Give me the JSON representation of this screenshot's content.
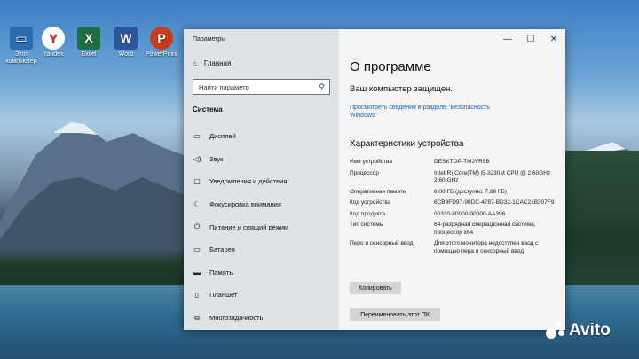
{
  "desktop": {
    "icons": [
      {
        "label": "Этот компьютер",
        "icon": "computer-icon",
        "glyph": "▭",
        "bg": "#2b6cb3",
        "fg": "#ffffff"
      },
      {
        "label": "Yandex",
        "icon": "yandex-browser-icon",
        "glyph": "Y",
        "bg": "#ffffff",
        "fg": "#e02a2a"
      },
      {
        "label": "Excel",
        "icon": "excel-icon",
        "glyph": "X",
        "bg": "#1d7044",
        "fg": "#ffffff"
      },
      {
        "label": "Word",
        "icon": "word-icon",
        "glyph": "W",
        "bg": "#2b579a",
        "fg": "#ffffff"
      },
      {
        "label": "PowerPoint",
        "icon": "powerpoint-icon",
        "glyph": "P",
        "bg": "#c43e1c",
        "fg": "#ffffff"
      }
    ]
  },
  "window": {
    "title": "Параметры",
    "controls": {
      "minimize": "—",
      "maximize": "☐",
      "close": "✕"
    }
  },
  "sidebar": {
    "home": {
      "label": "Главная",
      "icon": "home-icon"
    },
    "search": {
      "placeholder": "Найти параметр",
      "icon": "search-icon"
    },
    "section": "Система",
    "items": [
      {
        "label": "Дисплей",
        "icon": "display-icon",
        "glyph": "▭"
      },
      {
        "label": "Звук",
        "icon": "sound-icon",
        "glyph": "◁)"
      },
      {
        "label": "Уведомления и действия",
        "icon": "notifications-icon",
        "glyph": "▢"
      },
      {
        "label": "Фокусировка внимания",
        "icon": "focus-assist-icon",
        "glyph": "☾"
      },
      {
        "label": "Питание и спящий режим",
        "icon": "power-icon",
        "glyph": "⏻"
      },
      {
        "label": "Батарея",
        "icon": "battery-icon",
        "glyph": "▭"
      },
      {
        "label": "Память",
        "icon": "storage-icon",
        "glyph": "▬"
      },
      {
        "label": "Планшет",
        "icon": "tablet-icon",
        "glyph": "▯"
      },
      {
        "label": "Многозадачность",
        "icon": "multitasking-icon",
        "glyph": "⧉"
      }
    ]
  },
  "main": {
    "heading": "О программе",
    "protection": "Ваш компьютер защищен.",
    "security_link": "Просмотреть сведения в разделе \"Безопасность Windows\"",
    "specs_heading": "Характеристики устройства",
    "specs": [
      {
        "key": "Имя устройства",
        "value": "DESKTOP-TMJVR9B"
      },
      {
        "key": "Процессор",
        "value": "Intel(R) Core(TM) i5-3230M CPU @ 2.60GHz   2.60 GHz"
      },
      {
        "key": "Оперативная память",
        "value": "8,00 ГБ (доступно: 7,89 ГБ)"
      },
      {
        "key": "Код устройства",
        "value": "6CB9FD97-90DC-4787-BD32-1CAC21B307F9"
      },
      {
        "key": "Код продукта",
        "value": "00330-80000-00000-AA396"
      },
      {
        "key": "Тип системы",
        "value": "64-разрядная операционная система, процессор x64"
      },
      {
        "key": "Перо и сенсорный ввод",
        "value": "Для этого монитора недоступен ввод с помощью пера и сенсорный ввод"
      }
    ],
    "copy_button": "Копировать",
    "rename_button": "Переименовать этот ПК"
  },
  "watermark": {
    "text": "Avito"
  }
}
